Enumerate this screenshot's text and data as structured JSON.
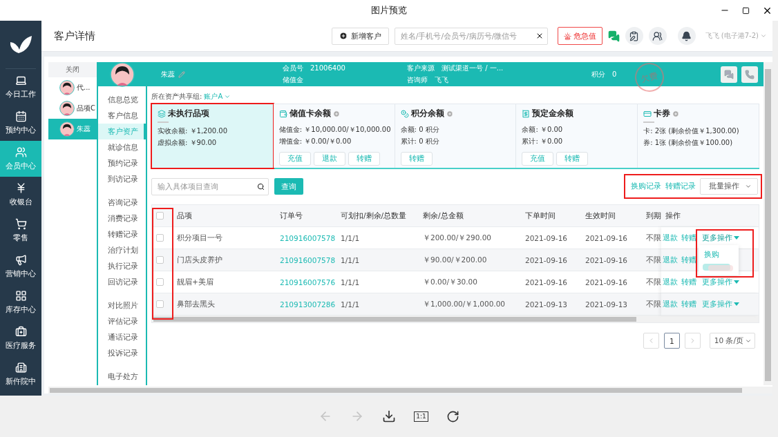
{
  "viewer": {
    "title": "图片预览",
    "toolbar": [
      {
        "kind": "prev",
        "disabled": true
      },
      {
        "kind": "next",
        "disabled": true
      },
      {
        "kind": "download",
        "disabled": false
      },
      {
        "kind": "actual",
        "label": "1:1",
        "disabled": false
      },
      {
        "kind": "rotate",
        "disabled": false
      }
    ]
  },
  "nav": [
    {
      "label": "今日工作",
      "selected": false
    },
    {
      "label": "预约中心",
      "selected": false
    },
    {
      "label": "会员中心",
      "selected": true
    },
    {
      "label": "收银台",
      "selected": false
    },
    {
      "label": "零售",
      "selected": false
    },
    {
      "label": "营销中心",
      "selected": false
    },
    {
      "label": "库存中心",
      "selected": false
    },
    {
      "label": "医疗服务",
      "selected": false
    },
    {
      "label": "新仵院中",
      "selected": false
    }
  ],
  "header": {
    "title": "客户详情",
    "new_button": "新增客户",
    "search": {
      "placeholder": "姓名/手机号/会员号/病历号/微信号"
    },
    "alert_button": "危急值",
    "user": "飞飞 (电子港7-2)"
  },
  "customer_tabs": {
    "close": "关闭",
    "items": [
      {
        "name": "代...",
        "selected": false
      },
      {
        "name": "品项C",
        "selected": false
      },
      {
        "name": "朱蕊",
        "selected": true
      }
    ]
  },
  "customer": {
    "name": "朱蕊",
    "columns": [
      [
        {
          "label": "会员号",
          "value": "21006400"
        },
        {
          "label": "储值金"
        }
      ],
      [
        {
          "label": "客户来源",
          "value": "测试渠道一号 / 一..."
        },
        {
          "label": "咨询师",
          "value": "飞飞"
        }
      ],
      [
        {
          "label": "积分",
          "value": "0"
        }
      ]
    ],
    "stamp": "欠费"
  },
  "subnav": [
    [
      {
        "label": "信息总览",
        "selected": false
      },
      {
        "label": "客户信息",
        "selected": false
      },
      {
        "label": "客户资产",
        "selected": true
      },
      {
        "label": "就诊信息",
        "selected": false
      },
      {
        "label": "预约记录",
        "selected": false
      },
      {
        "label": "到访记录",
        "selected": false
      }
    ],
    [
      {
        "label": "咨询记录",
        "selected": false
      },
      {
        "label": "消费记录",
        "selected": false
      },
      {
        "label": "转赠记录",
        "selected": false
      },
      {
        "label": "治疗计划",
        "selected": false
      },
      {
        "label": "执行记录",
        "selected": false
      },
      {
        "label": "回访记录",
        "selected": false
      }
    ],
    [
      {
        "label": "对比照片",
        "selected": false
      },
      {
        "label": "评估记录",
        "selected": false
      },
      {
        "label": "通话记录",
        "selected": false
      },
      {
        "label": "投诉记录",
        "selected": false
      }
    ],
    [
      {
        "label": "电子处方",
        "selected": false
      }
    ]
  ],
  "share_group": {
    "label": "所在资产共享组:",
    "value": "账户A"
  },
  "cards": [
    {
      "title": "未执行品项",
      "info": false,
      "selected": true,
      "lines": [
        {
          "label": "实收余额:",
          "value": "￥1,200.00"
        },
        {
          "label": "虚拟余额:",
          "value": "￥90.00"
        }
      ]
    },
    {
      "title": "储值卡余额",
      "info": true,
      "selected": false,
      "lines": [
        {
          "label": "储值金:",
          "value": "￥10,000.00/￥10,000.00"
        },
        {
          "label": "增值金:",
          "value": "￥0.00/￥0.00"
        }
      ],
      "buttons": [
        "充值",
        "退款",
        "转赠"
      ]
    },
    {
      "title": "积分余额",
      "info": true,
      "selected": false,
      "lines": [
        {
          "label": "余额:",
          "value": "0 积分"
        },
        {
          "label": "累计:",
          "value": "0 积分"
        }
      ],
      "buttons": [
        "转赠"
      ]
    },
    {
      "title": "预定金余额",
      "info": false,
      "selected": false,
      "lines": [
        {
          "label": "余额:",
          "value": "￥0.00"
        },
        {
          "label": "累计:",
          "value": "￥0.00"
        }
      ],
      "buttons": [
        "充值",
        "转赠"
      ]
    },
    {
      "title": "卡券",
      "info": true,
      "selected": false,
      "lines": [
        {
          "label": "卡:",
          "value": "2张 (剩余价值￥1,300.00)"
        },
        {
          "label": "券:",
          "value": "1张 (剩余价值￥100.00)"
        }
      ]
    }
  ],
  "query": {
    "placeholder": "输入具体项目查询",
    "button": "查询"
  },
  "links": [
    "换购记录",
    "转赠记录"
  ],
  "batch": "批量操作",
  "table": {
    "header_checked": false,
    "columns": [
      "品项",
      "订单号",
      "可划扣/剩余/总数量",
      "剩余/总金额",
      "下单时间",
      "生效时间",
      "到期",
      "操作"
    ],
    "rows": [
      {
        "checked": false,
        "cells": [
          "积分项目一号",
          "210916007578",
          "1/1/1",
          "￥200.00/￥290.00",
          "2021-09-16",
          "2021-09-16",
          "不限"
        ],
        "actions": [
          "退款",
          "转赠"
        ],
        "more": "更多操作",
        "expanded": true
      },
      {
        "checked": false,
        "cells": [
          "门店头皮养护",
          "210916007578",
          "1/1/1",
          "￥90.00/￥200.00",
          "2021-09-16",
          "2021-09-16",
          "不限"
        ],
        "actions": [
          "退款",
          "转赠"
        ]
      },
      {
        "checked": false,
        "cells": [
          "靓眉+美眉",
          "210916007576",
          "1/1/1",
          "￥0.00/￥30.00",
          "2021-09-16",
          "2021-09-16",
          "不限"
        ],
        "actions": [
          "退款",
          "转赠"
        ],
        "more": "更多操作",
        "expanded": false
      },
      {
        "checked": false,
        "cells": [
          "鼻部去黑头",
          "210913007286",
          "1/1/1",
          "￥1,000.00/￥1,000.00",
          "2021-09-13",
          "2021-09-13",
          "不限"
        ],
        "actions": [
          "退款",
          "转赠"
        ],
        "more": "更多操作",
        "expanded": false
      }
    ]
  },
  "dropdown": {
    "items": [
      "换购"
    ]
  },
  "pagination": {
    "pages": [
      {
        "label": "1",
        "selected": true
      }
    ],
    "page_size": "10 条/页"
  }
}
